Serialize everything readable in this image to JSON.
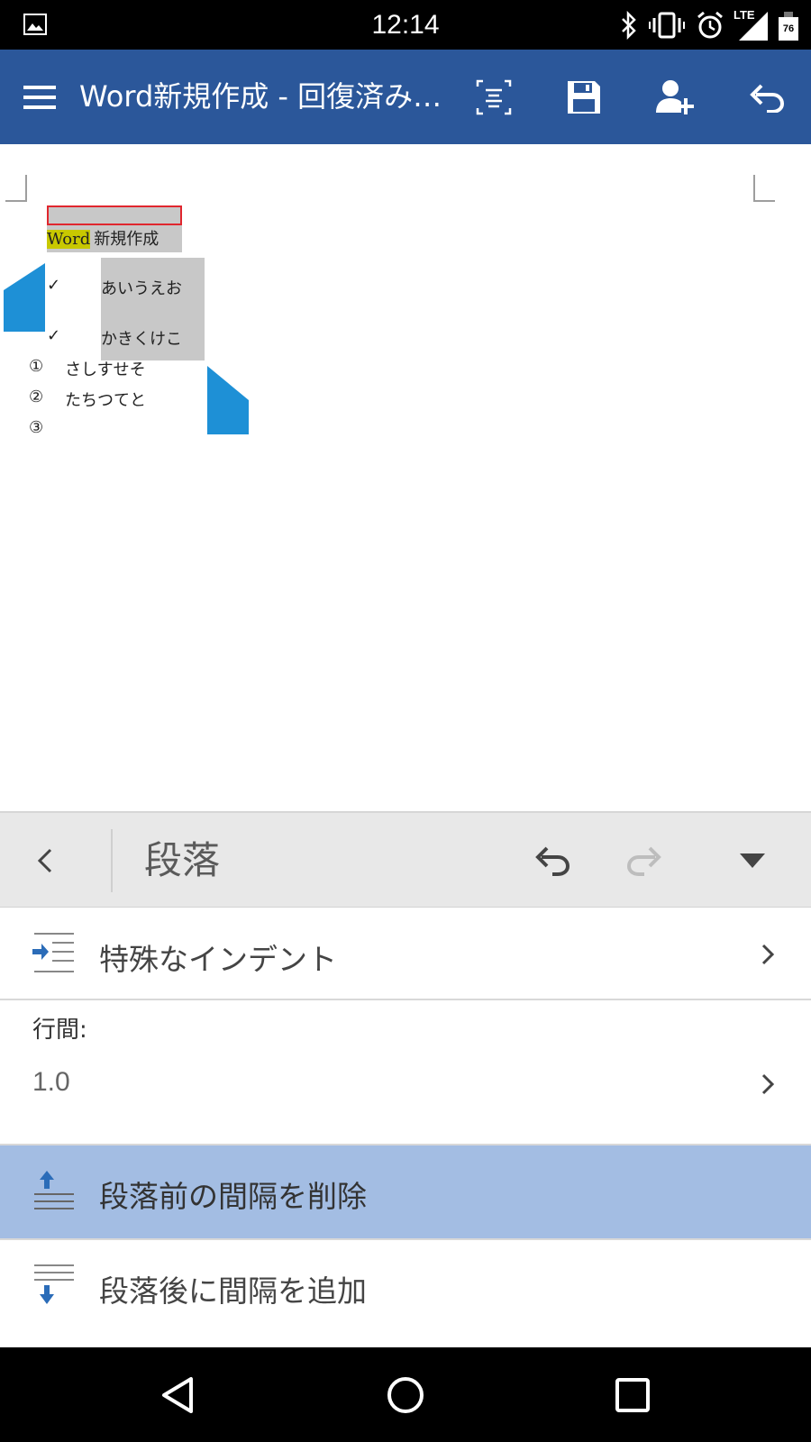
{
  "status_bar": {
    "time": "12:14",
    "network": "LTE",
    "battery": "76",
    "icons": [
      "gallery-icon",
      "bluetooth-icon",
      "vibrate-icon",
      "alarm-icon",
      "signal-icon",
      "battery-icon"
    ]
  },
  "app_bar": {
    "title": "Word新規作成 - 回復済み…",
    "color": "#2b579a",
    "actions": [
      "reading-view-icon",
      "save-icon",
      "share-icon",
      "undo-icon"
    ]
  },
  "document": {
    "line1_word": "Word",
    "line1_rest": "新規作成",
    "checklist": [
      {
        "mark": "✓",
        "text": "あいうえお"
      },
      {
        "mark": "✓",
        "text": "かきくけこ"
      }
    ],
    "numbered": [
      {
        "mark": "①",
        "text": "さしすせそ"
      },
      {
        "mark": "②",
        "text": "たちつてと"
      },
      {
        "mark": "③",
        "text": ""
      }
    ]
  },
  "panel": {
    "title": "段落",
    "special_indent": "特殊なインデント",
    "line_spacing_label": "行間:",
    "line_spacing_value": "1.0",
    "remove_space_before": "段落前の間隔を削除",
    "add_space_after": "段落後に間隔を追加",
    "highlight_color": "#a3bde3"
  },
  "nav_bar": {
    "buttons": [
      "back-icon",
      "home-icon",
      "recents-icon"
    ]
  }
}
